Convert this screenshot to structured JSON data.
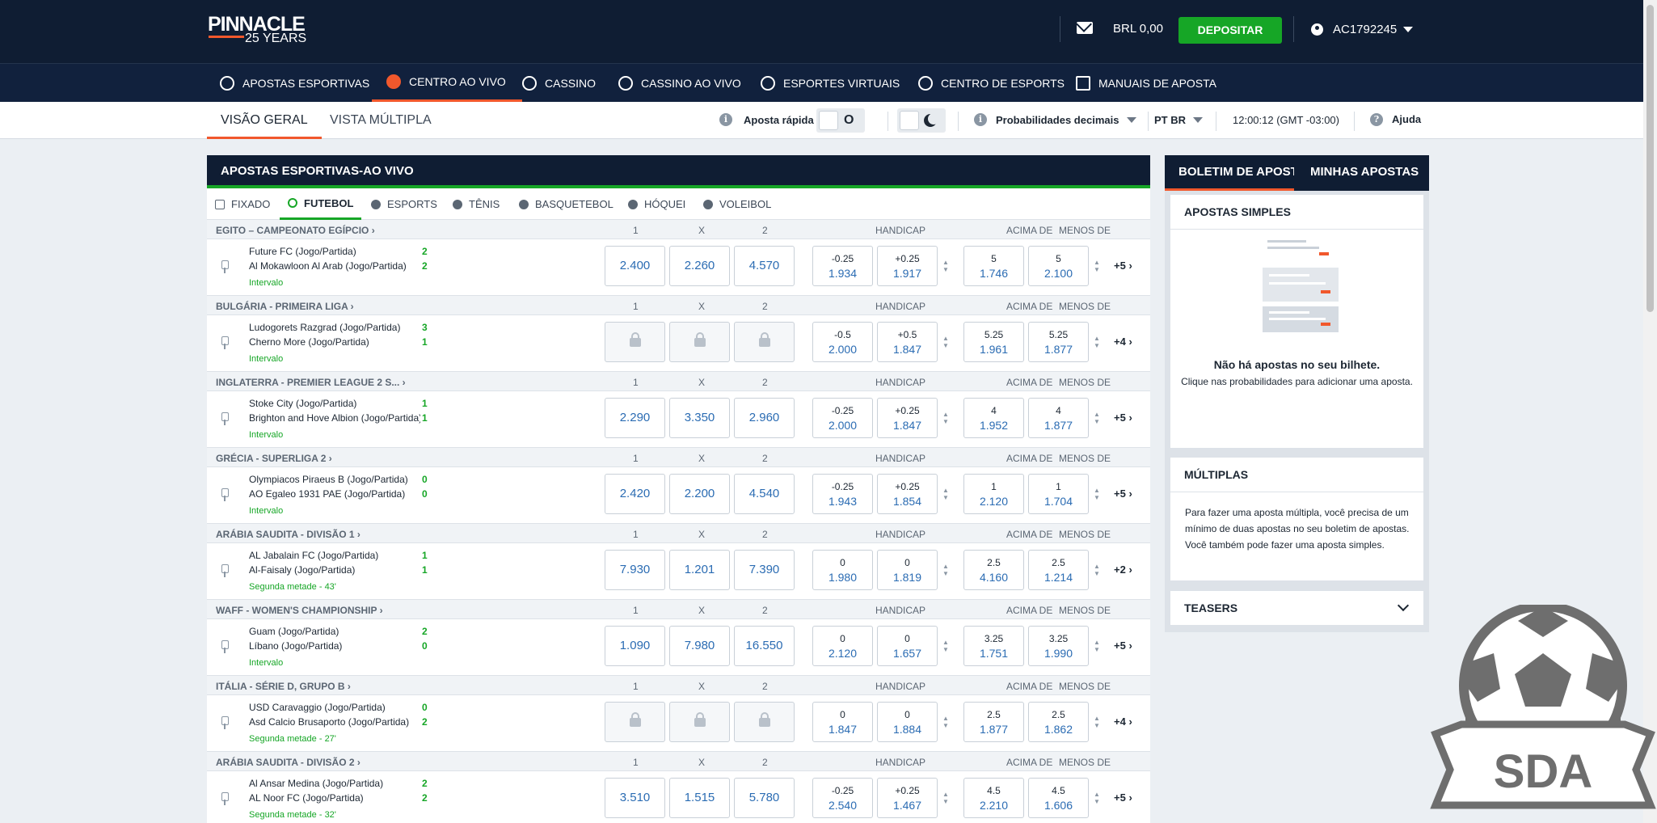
{
  "header": {
    "logo_top": "PINNACLE",
    "logo_bottom": "25 YEARS",
    "mail_icon": "mail-icon",
    "balance": "BRL 0,00",
    "deposit_label": "DEPOSITAR",
    "user_id": "AC1792245"
  },
  "nav": [
    {
      "label": "APOSTAS ESPORTIVAS",
      "icon": "soccer-ball-icon"
    },
    {
      "label": "CENTRO AO VIVO",
      "icon": "live-icon",
      "active": true
    },
    {
      "label": "CASSINO",
      "icon": "cherries-icon"
    },
    {
      "label": "CASSINO AO VIVO",
      "icon": "roulette-icon"
    },
    {
      "label": "ESPORTES VIRTUAIS",
      "icon": "virtual-sports-icon"
    },
    {
      "label": "CENTRO DE ESPORTS",
      "icon": "headset-icon"
    },
    {
      "label": "MANUAIS DE APOSTA",
      "icon": "manual-icon"
    }
  ],
  "subbar": {
    "tab_overview": "VISÃO GERAL",
    "tab_multi": "VISTA MÚLTIPLA",
    "quick_bet_label": "Aposta rápida",
    "quick_bet_value": "O",
    "odds_format": "Probabilidades decimais",
    "language": "PT BR",
    "time": "12:00:12 (GMT -03:00)",
    "help": "Ajuda"
  },
  "main": {
    "title": "APOSTAS ESPORTIVAS-AO VIVO",
    "tabs": [
      {
        "label": "FIXADO",
        "icon": "pin-icon"
      },
      {
        "label": "FUTEBOL",
        "icon": "soccer-ball-icon",
        "active": true
      },
      {
        "label": "ESPORTS",
        "icon": "headset-icon"
      },
      {
        "label": "TÊNIS",
        "icon": "tennis-ball-icon"
      },
      {
        "label": "BASQUETEBOL",
        "icon": "basketball-icon"
      },
      {
        "label": "HÓQUEI",
        "icon": "hockey-icon"
      },
      {
        "label": "VOLEIBOL",
        "icon": "volleyball-icon"
      }
    ],
    "col_1": "1",
    "col_x": "X",
    "col_2": "2",
    "col_handicap": "HANDICAP",
    "col_over": "ACIMA DE",
    "col_under": "MENOS DE",
    "leagues": [
      {
        "name": "EGITO – CAMPEONATO EGÍPCIO ›",
        "home": "Future FC (Jogo/Partida)",
        "away": "Al Mokawloon Al Arab (Jogo/Partida)",
        "home_score": "2",
        "away_score": "2",
        "status": "Intervalo",
        "odds": [
          "2.400",
          "2.260",
          "4.570"
        ],
        "hcp": [
          [
            "-0.25",
            "1.934"
          ],
          [
            "+0.25",
            "1.917"
          ]
        ],
        "ou": [
          [
            "5",
            "1.746"
          ],
          [
            "5",
            "2.100"
          ]
        ],
        "more": "+5"
      },
      {
        "name": "BULGÁRIA - PRIMEIRA LIGA ›",
        "home": "Ludogorets Razgrad (Jogo/Partida)",
        "away": "Cherno More (Jogo/Partida)",
        "home_score": "3",
        "away_score": "1",
        "status": "Intervalo",
        "odds": null,
        "hcp": [
          [
            "-0.5",
            "2.000"
          ],
          [
            "+0.5",
            "1.847"
          ]
        ],
        "ou": [
          [
            "5.25",
            "1.961"
          ],
          [
            "5.25",
            "1.877"
          ]
        ],
        "more": "+4"
      },
      {
        "name": "INGLATERRA - PREMIER LEAGUE 2 S... ›",
        "home": "Stoke City (Jogo/Partida)",
        "away": "Brighton and Hove Albion (Jogo/Partida)",
        "home_score": "1",
        "away_score": "1",
        "status": "Intervalo",
        "odds": [
          "2.290",
          "3.350",
          "2.960"
        ],
        "hcp": [
          [
            "-0.25",
            "2.000"
          ],
          [
            "+0.25",
            "1.847"
          ]
        ],
        "ou": [
          [
            "4",
            "1.952"
          ],
          [
            "4",
            "1.877"
          ]
        ],
        "more": "+5"
      },
      {
        "name": "GRÉCIA - SUPERLIGA 2 ›",
        "home": "Olympiacos Piraeus B (Jogo/Partida)",
        "away": "AO Egaleo 1931 PAE (Jogo/Partida)",
        "home_score": "0",
        "away_score": "0",
        "status": "Intervalo",
        "odds": [
          "2.420",
          "2.200",
          "4.540"
        ],
        "hcp": [
          [
            "-0.25",
            "1.943"
          ],
          [
            "+0.25",
            "1.854"
          ]
        ],
        "ou": [
          [
            "1",
            "2.120"
          ],
          [
            "1",
            "1.704"
          ]
        ],
        "more": "+5"
      },
      {
        "name": "ARÁBIA SAUDITA - DIVISÃO 1 ›",
        "home": "AL Jabalain FC (Jogo/Partida)",
        "away": "Al-Faisaly (Jogo/Partida)",
        "home_score": "1",
        "away_score": "1",
        "status": "Segunda metade - 43'",
        "odds": [
          "7.930",
          "1.201",
          "7.390"
        ],
        "hcp": [
          [
            "0",
            "1.980"
          ],
          [
            "0",
            "1.819"
          ]
        ],
        "ou": [
          [
            "2.5",
            "4.160"
          ],
          [
            "2.5",
            "1.214"
          ]
        ],
        "more": "+2"
      },
      {
        "name": "WAFF - WOMEN'S CHAMPIONSHIP ›",
        "home": "Guam (Jogo/Partida)",
        "away": "Líbano (Jogo/Partida)",
        "home_score": "2",
        "away_score": "0",
        "status": "Intervalo",
        "odds": [
          "1.090",
          "7.980",
          "16.550"
        ],
        "hcp": [
          [
            "0",
            "2.120"
          ],
          [
            "0",
            "1.657"
          ]
        ],
        "ou": [
          [
            "3.25",
            "1.751"
          ],
          [
            "3.25",
            "1.990"
          ]
        ],
        "more": "+5"
      },
      {
        "name": "ITÁLIA - SÉRIE D, GRUPO B ›",
        "home": "USD Caravaggio (Jogo/Partida)",
        "away": "Asd Calcio Brusaporto (Jogo/Partida)",
        "home_score": "0",
        "away_score": "2",
        "status": "Segunda metade - 27'",
        "odds": null,
        "hcp": [
          [
            "0",
            "1.847"
          ],
          [
            "0",
            "1.884"
          ]
        ],
        "ou": [
          [
            "2.5",
            "1.877"
          ],
          [
            "2.5",
            "1.862"
          ]
        ],
        "more": "+4"
      },
      {
        "name": "ARÁBIA SAUDITA - DIVISÃO 2 ›",
        "home": "Al Ansar Medina (Jogo/Partida)",
        "away": "AL Noor FC (Jogo/Partida)",
        "home_score": "2",
        "away_score": "2",
        "status": "Segunda metade - 32'",
        "odds": [
          "3.510",
          "1.515",
          "5.780"
        ],
        "hcp": [
          [
            "-0.25",
            "2.540"
          ],
          [
            "+0.25",
            "1.467"
          ]
        ],
        "ou": [
          [
            "4.5",
            "2.210"
          ],
          [
            "4.5",
            "1.606"
          ]
        ],
        "more": "+5"
      }
    ]
  },
  "betslip": {
    "tab_slip": "BOLETIM DE APOSTAS",
    "tab_mine": "MINHAS APOSTAS",
    "singles_title": "APOSTAS SIMPLES",
    "empty_title": "Não há apostas no seu bilhete.",
    "empty_sub": "Clique nas probabilidades para adicionar uma aposta.",
    "multi_title": "MÚLTIPLAS",
    "multi_text": "Para fazer uma aposta múltipla, você precisa de um mínimo de duas apostas no seu boletim de apostas. Você também pode fazer uma aposta simples.",
    "teasers": "TEASERS"
  },
  "watermark": "SDA",
  "colors": {
    "navy": "#0f1d33",
    "green": "#16a626",
    "orange": "#f1582c",
    "odds_blue": "#2b6cb3"
  }
}
